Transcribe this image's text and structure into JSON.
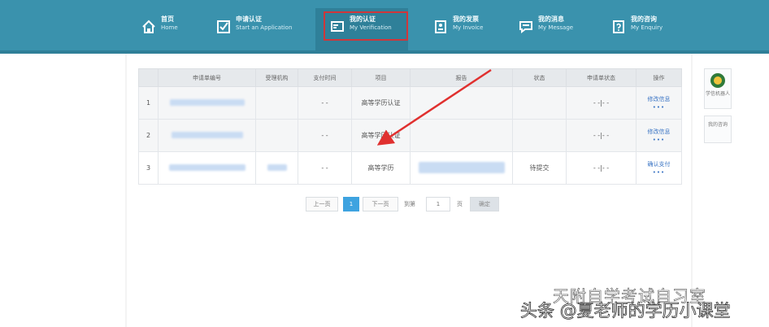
{
  "nav": {
    "items": [
      {
        "cn": "首页",
        "en": "Home",
        "icon": "home-icon"
      },
      {
        "cn": "申请认证",
        "en": "Start an Application",
        "icon": "checkbox-icon"
      },
      {
        "cn": "我的认证",
        "en": "My Verification",
        "icon": "certificate-icon"
      },
      {
        "cn": "我的发票",
        "en": "My Invoice",
        "icon": "invoice-icon"
      },
      {
        "cn": "我的消息",
        "en": "My Message",
        "icon": "message-icon"
      },
      {
        "cn": "我的咨询",
        "en": "My Enquiry",
        "icon": "enquiry-icon"
      }
    ],
    "active_index": 2
  },
  "table": {
    "headers": [
      "",
      "申请单编号",
      "受理机构",
      "支付时间",
      "项目",
      "报告",
      "状态",
      "申请单状态",
      "操作"
    ],
    "rows": [
      {
        "index": "1",
        "pay_time": "- -",
        "project": "高等学历认证",
        "status": "",
        "app_status": "- -|- -",
        "action": "修改信息",
        "action_more": "•••"
      },
      {
        "index": "2",
        "pay_time": "- -",
        "project": "高等学历认证",
        "status": "",
        "app_status": "- -|- -",
        "action": "修改信息",
        "action_more": "•••"
      },
      {
        "index": "3",
        "pay_time": "- -",
        "project": "高等学历",
        "status": "待提交",
        "app_status": "- -|- -",
        "action": "确认支付",
        "action_more": "•••"
      }
    ]
  },
  "pager": {
    "prev": "上一页",
    "current": "1",
    "next": "下一页",
    "goto_label": "到第",
    "page_value": "1",
    "page_unit": "页",
    "confirm": "确定"
  },
  "side": {
    "card1": "学信机器人",
    "card2": "我的咨询"
  },
  "watermark": {
    "line1": "天附自学考试自习室",
    "line2": "头条 @夏老师的学历小课堂"
  },
  "colors": {
    "topbar": "#3a92ad",
    "highlight": "#d0363a",
    "link": "#3a74c4",
    "current_page": "#3ea3e0"
  }
}
